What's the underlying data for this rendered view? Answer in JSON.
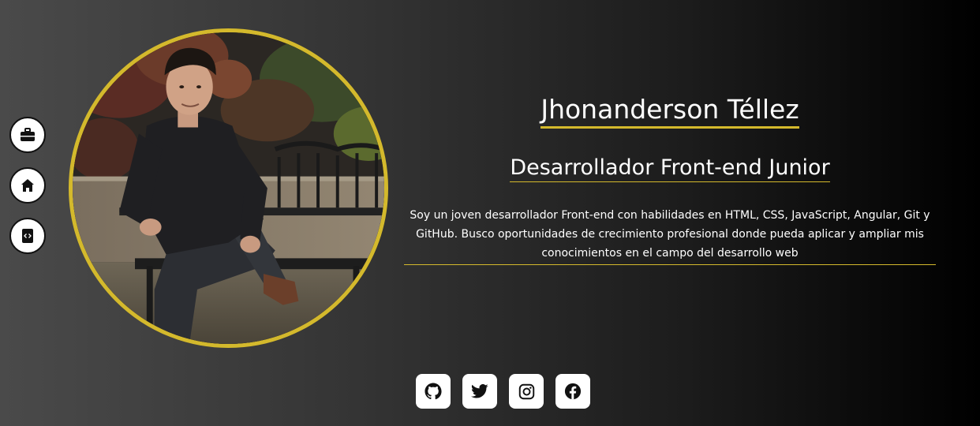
{
  "profile": {
    "name": "Jhonanderson Téllez",
    "role": "Desarrollador Front-end Junior",
    "bio": "Soy un joven desarrollador Front-end con habilidades en HTML, CSS, JavaScript, Angular, Git y GitHub. Busco oportunidades de crecimiento profesional donde pueda aplicar y ampliar mis conocimientos en el campo del desarrollo web"
  },
  "side_nav": {
    "items": [
      {
        "icon": "briefcase-icon"
      },
      {
        "icon": "home-icon"
      },
      {
        "icon": "code-file-icon"
      }
    ]
  },
  "social": {
    "items": [
      {
        "icon": "github-icon"
      },
      {
        "icon": "twitter-icon"
      },
      {
        "icon": "instagram-icon"
      },
      {
        "icon": "facebook-icon"
      }
    ]
  },
  "colors": {
    "accent": "#d4b92c",
    "background_left": "#4a4a4a",
    "background_right": "#000000",
    "button_bg": "#ffffff",
    "icon": "#111111"
  }
}
